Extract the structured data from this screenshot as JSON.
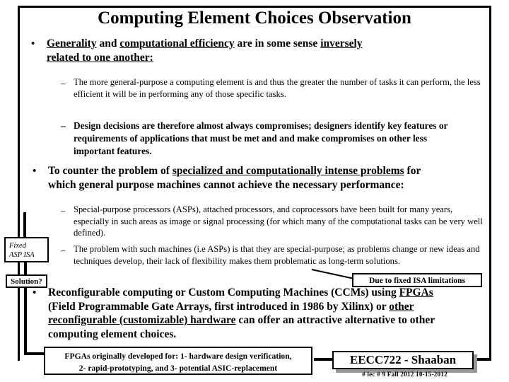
{
  "slide": {
    "title": "Computing Element Choices Observation",
    "bullet_marker": "•",
    "dash_marker": "–",
    "body": {
      "b1": {
        "text_runs": "Generality and computational efficiency are in some sense inversely related to one another:",
        "line1_a": "Generality",
        "line1_b": " and ",
        "line1_c": "computational efficiency",
        "line1_d": " are in some sense ",
        "line1_e": "inversely",
        "line2": "related to one another:"
      },
      "b1s1": "The more general-purpose a computing element is and thus the greater the number of tasks it can perform, the less efficient it will be in performing any of those specific tasks.",
      "b1s2": "Design decisions are therefore almost always compromises; designers identify key features or requirements of applications that must be met and and make compromises on other less important features.",
      "b2": {
        "line1_a": "To counter the problem of ",
        "line1_b": "specialized and computationally intense problems",
        "line1_c": " for",
        "line2": "which general purpose machines cannot achieve the necessary performance:"
      },
      "b2s1": "Special-purpose processors (ASPs), attached processors, and coprocessors have been built for many years, especially in such areas as image or signal processing (for which many of the computational tasks can be very well defined).",
      "b2s2": "The problem with such machines (i.e ASPs) is that they are special-purpose; as problems change or new ideas and techniques develop, their lack of flexibility makes them problematic as long-term solutions.",
      "b3": {
        "line1_a": "Reconfigurable computing or Custom Computing Machines (CCMs) using ",
        "line1_b": "FPGAs",
        "line2_a": "(Field Programmable Gate Arrays, first introduced in 1986 by Xilinx) or ",
        "line2_b": "other",
        "line3_a": "reconfigurable (customizable) hardware",
        "line3_b": " can offer an attractive alternative to other",
        "line4": "computing element choices."
      }
    },
    "annotations": {
      "fixed_asp_isa_line1": "Fixed",
      "fixed_asp_isa_line2": "ASP ISA",
      "solution": "Solution?",
      "due_to_isa": "Due to fixed ISA limitations",
      "fpga_note_line1": "FPGAs originally developed for: 1- hardware design verification,",
      "fpga_note_line2": "2- rapid-prototyping, and 3- potential ASIC-replacement"
    },
    "footer": {
      "course": "EECC722 - Shaaban",
      "credits": "#  lec # 9    Fall 2012   10-15-2012"
    },
    "colors": {
      "text": "#000000",
      "background": "#ffffff",
      "shadow": "#9a9a9a"
    }
  }
}
